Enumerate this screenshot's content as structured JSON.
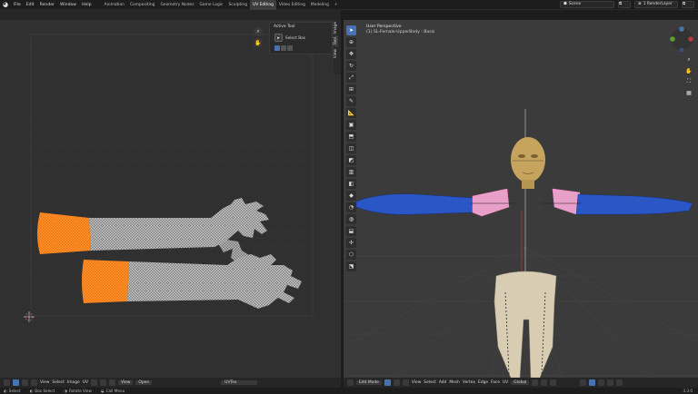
{
  "menu": [
    "File",
    "Edit",
    "Render",
    "Window",
    "Help"
  ],
  "workspaces": [
    "Animation",
    "Compositing",
    "Geometry Nodes",
    "Game Logic",
    "Sculpting",
    "UV Editing",
    "Video Editing",
    "Modeling"
  ],
  "active_workspace": "UV Editing",
  "add_workspace": "+",
  "scene": {
    "label": "Scene",
    "view_layer": "1 RenderLayer"
  },
  "uv_editor": {
    "sidebar_tabs": [
      "Image",
      "Tool",
      "View"
    ],
    "active_tool": {
      "title": "Active Tool",
      "tool_name": "Select Box"
    },
    "footer": {
      "view": "View",
      "select": "Select",
      "image": "Image",
      "uv": "UV",
      "view_menu": "View",
      "open": "Open",
      "uv_map": "UVTex"
    }
  },
  "viewport": {
    "info_line1": "User Perspective",
    "info_line2": "(1) SL-Female-UpperBody : Basis",
    "footer": {
      "mode": "Edit Mode",
      "view": "View",
      "select": "Select",
      "add": "Add",
      "mesh": "Mesh",
      "vertex": "Vertex",
      "edge": "Edge",
      "face": "Face",
      "uv": "UV",
      "orientation": "Global"
    }
  },
  "statusbar": {
    "select": "Select",
    "box_select": "Box Select",
    "rotate": "Rotate View",
    "call_menu": "Call Menu",
    "version": "3.3.0"
  },
  "colors": {
    "accent": "#4772b3",
    "uv_selected": "#f27a0f",
    "mesh_selected": "#e8a0c8",
    "mesh_body": "#2a56c6"
  }
}
